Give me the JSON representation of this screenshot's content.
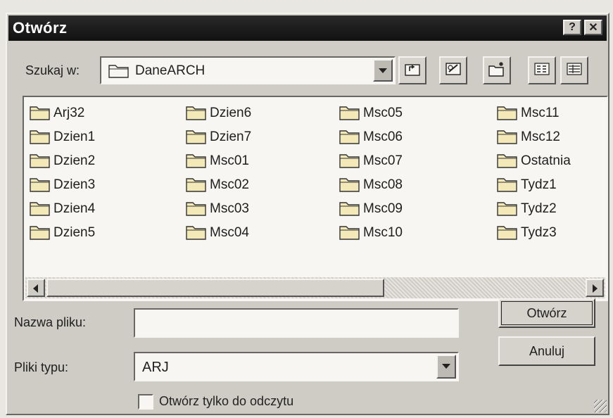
{
  "dialog": {
    "title": "Otwórz",
    "title_buttons": {
      "help": "?",
      "close": "✕"
    }
  },
  "lookin": {
    "label": "Szukaj w:",
    "value": "DaneARCH",
    "icon": "folder-icon"
  },
  "toolbar": {
    "items": [
      {
        "name": "up-one-level-button",
        "icon": "up-folder-icon"
      },
      {
        "name": "desktop-button",
        "icon": "desktop-icon"
      },
      {
        "name": "new-folder-button",
        "icon": "new-folder-icon"
      },
      {
        "name": "list-view-button",
        "icon": "list-view-icon"
      },
      {
        "name": "details-view-button",
        "icon": "details-view-icon"
      }
    ]
  },
  "files": {
    "columns": [
      [
        "Arj32",
        "Dzien1",
        "Dzien2",
        "Dzien3",
        "Dzien4",
        "Dzien5"
      ],
      [
        "Dzien6",
        "Dzien7",
        "Msc01",
        "Msc02",
        "Msc03",
        "Msc04"
      ],
      [
        "Msc05",
        "Msc06",
        "Msc07",
        "Msc08",
        "Msc09",
        "Msc10"
      ],
      [
        "Msc11",
        "Msc12",
        "Ostatnia",
        "Tydz1",
        "Tydz2",
        "Tydz3"
      ]
    ]
  },
  "filename": {
    "label": "Nazwa pliku:",
    "value": ""
  },
  "filetype": {
    "label": "Pliki typu:",
    "value": "ARJ"
  },
  "buttons": {
    "open": "Otwórz",
    "cancel": "Anuluj"
  },
  "readonly": {
    "label": "Otwórz tylko do odczytu",
    "checked": false
  },
  "colors": {
    "face": "#cfccc5",
    "titlebar": "#111111",
    "folder": "#f3e9b8"
  }
}
